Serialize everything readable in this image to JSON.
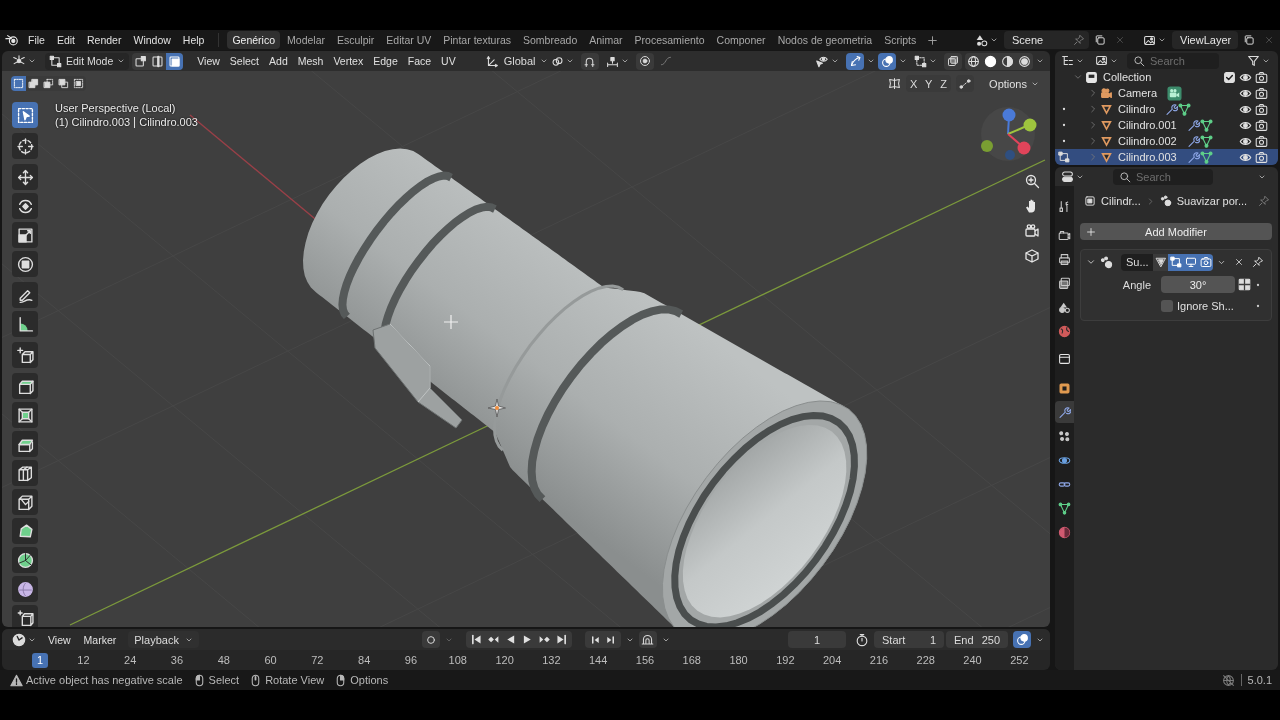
{
  "topbar": {
    "menus": [
      "File",
      "Edit",
      "Render",
      "Window",
      "Help"
    ],
    "workspaces": [
      {
        "label": "Genérico",
        "selected": true
      },
      {
        "label": "Modelar",
        "selected": false
      },
      {
        "label": "Esculpir",
        "selected": false
      },
      {
        "label": "Editar UV",
        "selected": false
      },
      {
        "label": "Pintar texturas",
        "selected": false
      },
      {
        "label": "Sombreado",
        "selected": false
      },
      {
        "label": "Animar",
        "selected": false
      },
      {
        "label": "Procesamiento",
        "selected": false
      },
      {
        "label": "Componer",
        "selected": false
      },
      {
        "label": "Nodos de geometria",
        "selected": false
      },
      {
        "label": "Scripts",
        "selected": false
      }
    ],
    "scene": "Scene",
    "view_layer": "ViewLayer"
  },
  "viewport": {
    "header": {
      "mode": "Edit Mode",
      "select_modes": [
        {
          "selected": false
        },
        {
          "selected": false
        },
        {
          "selected": true
        }
      ],
      "menus": [
        "View",
        "Select",
        "Add",
        "Mesh",
        "Vertex",
        "Edge",
        "Face",
        "UV"
      ],
      "orientation": "Global",
      "gizmos": {
        "on": true
      },
      "overlays": {
        "on": true
      },
      "shading": [
        {
          "selected": false
        },
        {
          "selected": true
        },
        {
          "selected": false
        },
        {
          "selected": false
        }
      ]
    },
    "tool_settings": {
      "select_ops": [
        {
          "selected": true
        },
        {
          "selected": false
        },
        {
          "selected": false
        },
        {
          "selected": false
        },
        {
          "selected": false
        }
      ],
      "mirror_axes": [
        {
          "label": "X",
          "on": false
        },
        {
          "label": "Y",
          "on": false
        },
        {
          "label": "Z",
          "on": false
        }
      ],
      "options": "Options"
    },
    "view_name": "User Perspective (Local)",
    "object_name": "(1) Cilindro.003",
    "mesh_name": "Cilindro.003",
    "tools": [
      {
        "selected": true
      },
      {
        "selected": false
      },
      {
        "selected": false
      },
      {
        "selected": false
      },
      {
        "selected": false
      },
      {
        "selected": false
      },
      {
        "selected": false
      },
      {
        "selected": false
      },
      {
        "selected": false
      },
      {
        "selected": false
      },
      {
        "selected": false
      },
      {
        "selected": false
      },
      {
        "selected": false
      },
      {
        "selected": false
      },
      {
        "selected": false
      },
      {
        "selected": false
      },
      {
        "selected": false
      },
      {
        "selected": false
      }
    ]
  },
  "timeline": {
    "menus": [
      "View",
      "Marker"
    ],
    "playback": "Playback",
    "current_frame": "1",
    "start_label": "Start",
    "start": "1",
    "end_label": "End",
    "end": "250",
    "frames": [
      {
        "label": "1",
        "selected": true
      },
      {
        "label": "12",
        "selected": false
      },
      {
        "label": "24",
        "selected": false
      },
      {
        "label": "36",
        "selected": false
      },
      {
        "label": "48",
        "selected": false
      },
      {
        "label": "60",
        "selected": false
      },
      {
        "label": "72",
        "selected": false
      },
      {
        "label": "84",
        "selected": false
      },
      {
        "label": "96",
        "selected": false
      },
      {
        "label": "108",
        "selected": false
      },
      {
        "label": "120",
        "selected": false
      },
      {
        "label": "132",
        "selected": false
      },
      {
        "label": "144",
        "selected": false
      },
      {
        "label": "156",
        "selected": false
      },
      {
        "label": "168",
        "selected": false
      },
      {
        "label": "180",
        "selected": false
      },
      {
        "label": "192",
        "selected": false
      },
      {
        "label": "204",
        "selected": false
      },
      {
        "label": "216",
        "selected": false
      },
      {
        "label": "228",
        "selected": false
      },
      {
        "label": "240",
        "selected": false
      },
      {
        "label": "252",
        "selected": false
      }
    ]
  },
  "outliner": {
    "search": {
      "placeholder": "Search"
    },
    "tree": [
      {
        "label": "Collection",
        "kind": "collection",
        "expanded": true,
        "selected": false,
        "checked": true,
        "visible": true,
        "renderable": true,
        "children": [
          {
            "label": "Camera",
            "kind": "camera",
            "expanded": false,
            "selected": false,
            "visible": true,
            "renderable": true
          },
          {
            "label": "Cilindro",
            "kind": "mesh",
            "expanded": false,
            "selected": false,
            "visible": true,
            "renderable": true
          },
          {
            "label": "Cilindro.001",
            "kind": "mesh",
            "expanded": false,
            "selected": false,
            "visible": true,
            "renderable": true
          },
          {
            "label": "Cilindro.002",
            "kind": "mesh",
            "expanded": false,
            "selected": false,
            "visible": true,
            "renderable": true
          },
          {
            "label": "Cilindro.003",
            "kind": "mesh",
            "expanded": false,
            "selected": true,
            "visible": true,
            "renderable": true
          }
        ]
      }
    ]
  },
  "properties": {
    "search": {
      "placeholder": "Search"
    },
    "tabs": [
      {
        "selected": false
      },
      {
        "selected": false
      },
      {
        "selected": false
      },
      {
        "selected": false
      },
      {
        "selected": false
      },
      {
        "selected": false
      },
      {
        "selected": false
      },
      {
        "selected": false
      },
      {
        "selected": true
      },
      {
        "selected": false
      },
      {
        "selected": false
      },
      {
        "selected": false
      },
      {
        "selected": false
      },
      {
        "selected": false
      }
    ],
    "breadcrumb": [
      "Cilindr...",
      "Suavizar por..."
    ],
    "add_modifier": "Add Modifier",
    "modifier": {
      "name": "Su...",
      "expanded": true,
      "toggles": [
        {
          "on": false
        },
        {
          "on": true
        },
        {
          "on": true
        },
        {
          "on": true
        }
      ],
      "angle_label": "Angle",
      "angle": "30°",
      "ignore_sharp": {
        "label": "Ignore Sh...",
        "checked": false
      }
    }
  },
  "status_bar": {
    "warning": "Active object has negative scale",
    "hints": [
      "Select",
      "Rotate View",
      "Options"
    ],
    "version": "5.0.1"
  }
}
